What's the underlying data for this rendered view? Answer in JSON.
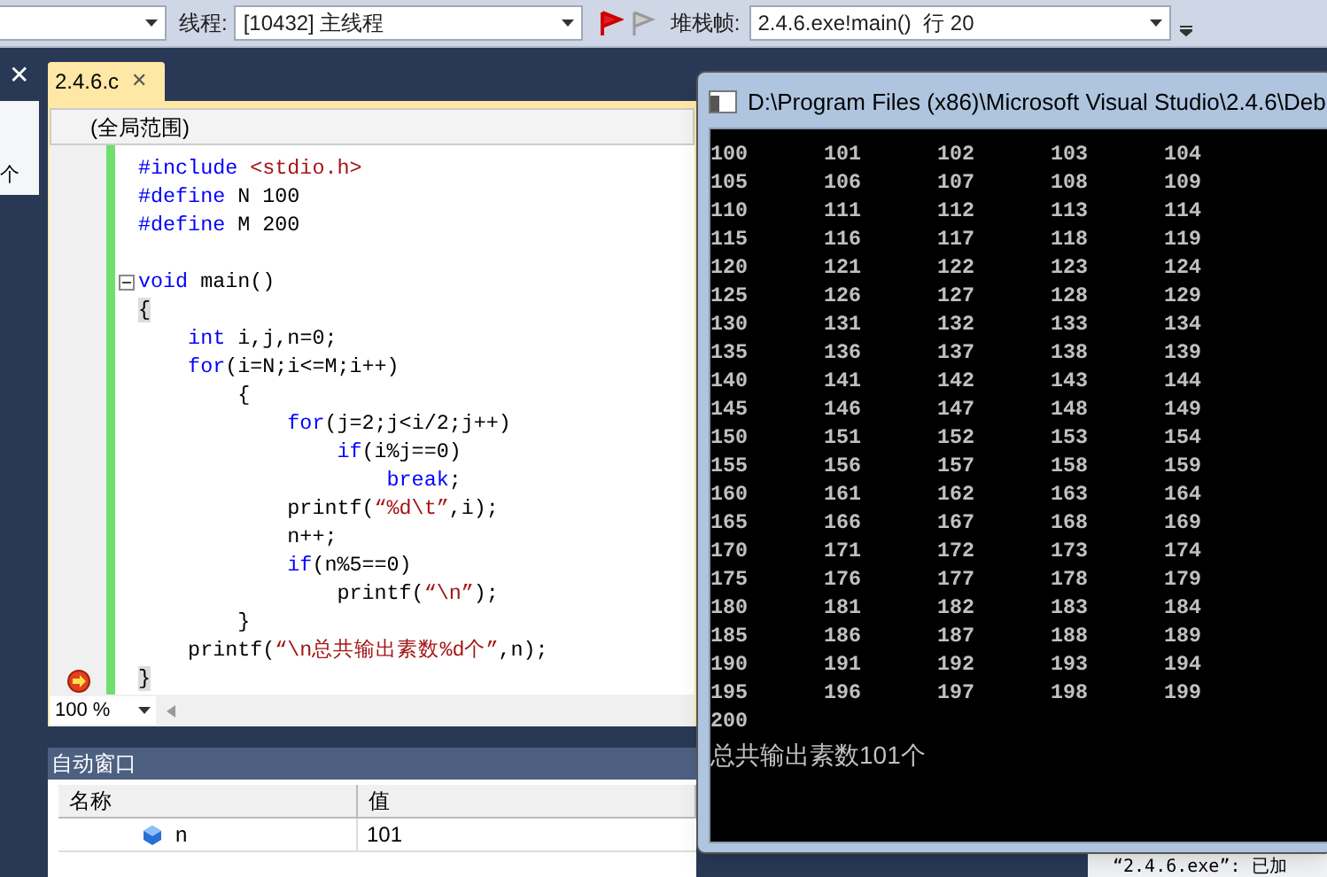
{
  "toolbar": {
    "thread_label": "线程:",
    "thread_value": "[10432] 主线程",
    "stack_label": "堆栈帧:",
    "stack_value": "2.4.6.exe!main()  行 20"
  },
  "left_panel": {
    "close": "✕",
    "text": "个"
  },
  "editor": {
    "tab": {
      "label": "2.4.6.c",
      "close": "✕",
      "selected": true
    },
    "scope": "(全局范围)",
    "zoom": "100 %",
    "lines": [
      {
        "current": false,
        "fold": false,
        "segments": [
          {
            "kind": "keyword",
            "text": "#include"
          },
          {
            "kind": "string",
            "text": " <stdio.h>"
          }
        ]
      },
      {
        "current": false,
        "fold": false,
        "segments": [
          {
            "kind": "keyword",
            "text": "#define"
          },
          {
            "kind": "plain",
            "text": " N 100"
          }
        ]
      },
      {
        "current": false,
        "fold": false,
        "segments": [
          {
            "kind": "keyword",
            "text": "#define"
          },
          {
            "kind": "plain",
            "text": " M 200"
          }
        ]
      },
      {
        "current": false,
        "fold": false
      },
      {
        "current": false,
        "fold": true,
        "segments": [
          {
            "kind": "keyword",
            "text": "void"
          },
          {
            "kind": "plain",
            "text": " main()"
          }
        ]
      },
      {
        "current": false,
        "fold": false,
        "segments": [
          {
            "kind": "brace",
            "text": "{"
          }
        ]
      },
      {
        "current": false,
        "fold": false,
        "segments": [
          {
            "kind": "keyword",
            "text": "    int"
          },
          {
            "kind": "plain",
            "text": " i,j,n=0;"
          }
        ]
      },
      {
        "current": false,
        "fold": false,
        "segments": [
          {
            "kind": "keyword",
            "text": "    for"
          },
          {
            "kind": "plain",
            "text": "(i=N;i<=M;i++)"
          }
        ]
      },
      {
        "current": false,
        "fold": false,
        "segments": [
          {
            "kind": "plain",
            "text": "        {"
          }
        ]
      },
      {
        "current": false,
        "fold": false,
        "segments": [
          {
            "kind": "keyword",
            "text": "            for"
          },
          {
            "kind": "plain",
            "text": "(j=2;j<i/2;j++)"
          }
        ]
      },
      {
        "current": false,
        "fold": false,
        "segments": [
          {
            "kind": "keyword",
            "text": "                if"
          },
          {
            "kind": "plain",
            "text": "(i%j==0)"
          }
        ]
      },
      {
        "current": false,
        "fold": false,
        "segments": [
          {
            "kind": "keyword",
            "text": "                    break"
          },
          {
            "kind": "plain",
            "text": ";"
          }
        ]
      },
      {
        "current": false,
        "fold": false,
        "segments": [
          {
            "kind": "plain",
            "text": "            printf("
          },
          {
            "kind": "string",
            "text": "“%d\\t”"
          },
          {
            "kind": "plain",
            "text": ",i);"
          }
        ]
      },
      {
        "current": false,
        "fold": false,
        "segments": [
          {
            "kind": "plain",
            "text": "            n++;"
          }
        ]
      },
      {
        "current": false,
        "fold": false,
        "segments": [
          {
            "kind": "keyword",
            "text": "            if"
          },
          {
            "kind": "plain",
            "text": "(n%5==0)"
          }
        ]
      },
      {
        "current": false,
        "fold": false,
        "segments": [
          {
            "kind": "plain",
            "text": "                printf("
          },
          {
            "kind": "string",
            "text": "“\\n”"
          },
          {
            "kind": "plain",
            "text": ");"
          }
        ]
      },
      {
        "current": false,
        "fold": false,
        "segments": [
          {
            "kind": "plain",
            "text": "        }"
          }
        ]
      },
      {
        "current": false,
        "fold": false,
        "segments": [
          {
            "kind": "plain",
            "text": "    printf("
          },
          {
            "kind": "string",
            "text": "“\\n总共输出素数%d个”"
          },
          {
            "kind": "plain",
            "text": ",n);"
          }
        ]
      },
      {
        "current": true,
        "fold": false,
        "segments": [
          {
            "kind": "brace",
            "text": "}"
          }
        ]
      }
    ]
  },
  "console": {
    "title": "D:\\Program Files (x86)\\Microsoft Visual Studio\\2.4.6\\Deb",
    "rows": [
      [
        "100",
        "101",
        "102",
        "103",
        "104"
      ],
      [
        "105",
        "106",
        "107",
        "108",
        "109"
      ],
      [
        "110",
        "111",
        "112",
        "113",
        "114"
      ],
      [
        "115",
        "116",
        "117",
        "118",
        "119"
      ],
      [
        "120",
        "121",
        "122",
        "123",
        "124"
      ],
      [
        "125",
        "126",
        "127",
        "128",
        "129"
      ],
      [
        "130",
        "131",
        "132",
        "133",
        "134"
      ],
      [
        "135",
        "136",
        "137",
        "138",
        "139"
      ],
      [
        "140",
        "141",
        "142",
        "143",
        "144"
      ],
      [
        "145",
        "146",
        "147",
        "148",
        "149"
      ],
      [
        "150",
        "151",
        "152",
        "153",
        "154"
      ],
      [
        "155",
        "156",
        "157",
        "158",
        "159"
      ],
      [
        "160",
        "161",
        "162",
        "163",
        "164"
      ],
      [
        "165",
        "166",
        "167",
        "168",
        "169"
      ],
      [
        "170",
        "171",
        "172",
        "173",
        "174"
      ],
      [
        "175",
        "176",
        "177",
        "178",
        "179"
      ],
      [
        "180",
        "181",
        "182",
        "183",
        "184"
      ],
      [
        "185",
        "186",
        "187",
        "188",
        "189"
      ],
      [
        "190",
        "191",
        "192",
        "193",
        "194"
      ],
      [
        "195",
        "196",
        "197",
        "198",
        "199"
      ],
      [
        "200"
      ]
    ],
    "summary": "总共输出素数101个"
  },
  "autos": {
    "title": "自动窗口",
    "columns": [
      "名称",
      "值"
    ],
    "rows": [
      {
        "name": "n",
        "value": "101"
      }
    ]
  },
  "output": {
    "text": "“2.4.6.exe”: 已加"
  }
}
